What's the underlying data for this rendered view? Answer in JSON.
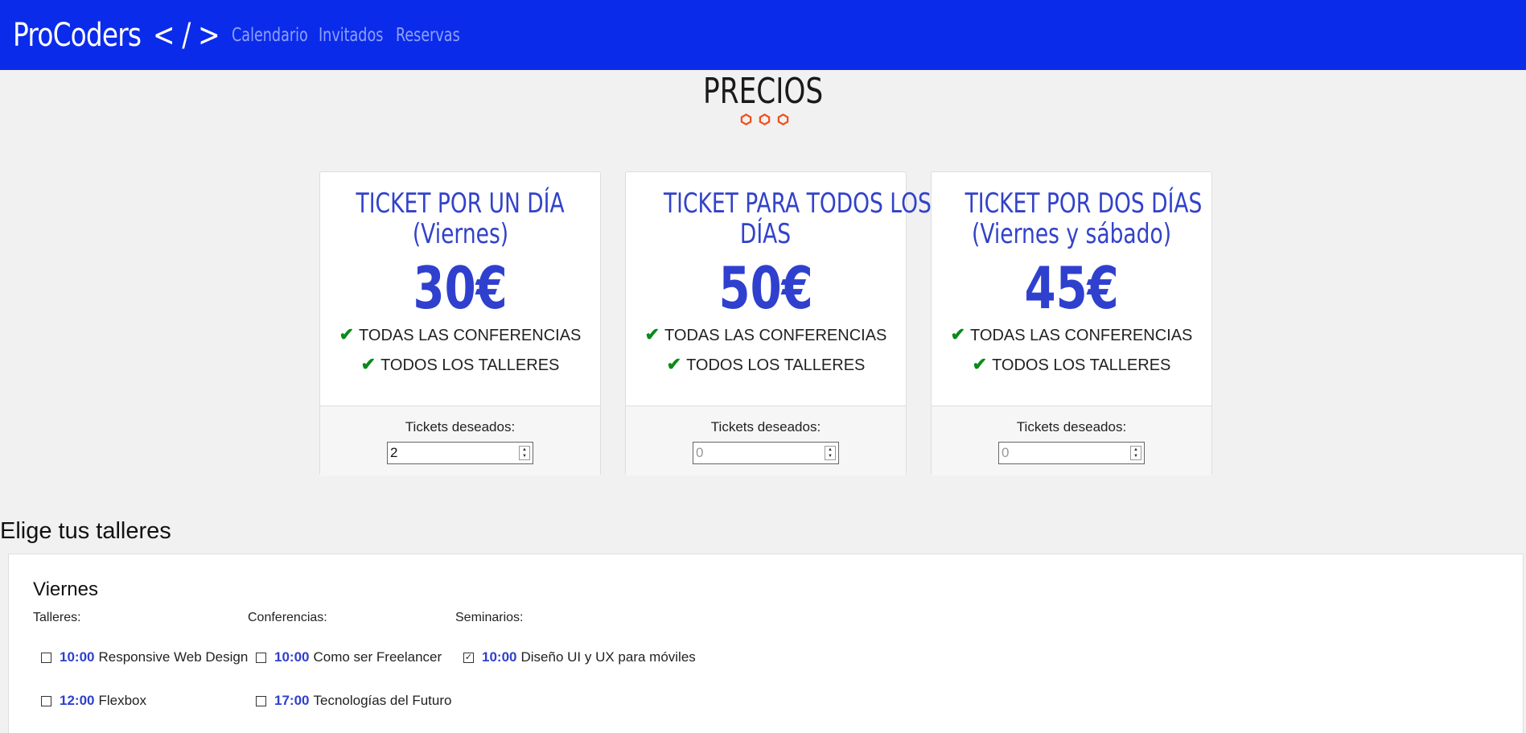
{
  "header": {
    "logo_text": "ProCoders",
    "logo_code": "< / >",
    "nav": [
      "Calendario",
      "Invitados",
      "Reservas"
    ]
  },
  "pricing": {
    "title": "PRECIOS",
    "cards": [
      {
        "title_line1": "TICKET POR UN DÍA",
        "title_line2": "(Viernes)",
        "price": "30€",
        "features": [
          "TODAS LAS CONFERENCIAS",
          "TODOS LOS TALLERES"
        ],
        "qty_label": "Tickets deseados:",
        "qty_value": "2",
        "qty_placeholder": ""
      },
      {
        "title_line1": "TICKET PARA TODOS LOS",
        "title_line2": "DÍAS",
        "price": "50€",
        "features": [
          "TODAS LAS CONFERENCIAS",
          "TODOS LOS TALLERES"
        ],
        "qty_label": "Tickets deseados:",
        "qty_value": "",
        "qty_placeholder": "0"
      },
      {
        "title_line1": "TICKET POR DOS DÍAS",
        "title_line2": "(Viernes y sábado)",
        "price": "45€",
        "features": [
          "TODAS LAS CONFERENCIAS",
          "TODOS LOS TALLERES"
        ],
        "qty_label": "Tickets deseados:",
        "qty_value": "",
        "qty_placeholder": "0"
      }
    ]
  },
  "workshops": {
    "title": "Elige tus talleres",
    "day": "Viernes",
    "columns": [
      {
        "label": "Talleres:",
        "items": [
          {
            "time": "10:00",
            "name": "Responsive Web Design",
            "checked": false
          },
          {
            "time": "12:00",
            "name": "Flexbox",
            "checked": false
          }
        ]
      },
      {
        "label": "Conferencias:",
        "items": [
          {
            "time": "10:00",
            "name": "Como ser Freelancer",
            "checked": false
          },
          {
            "time": "17:00",
            "name": "Tecnologías del Futuro",
            "checked": false
          }
        ]
      },
      {
        "label": "Seminarios:",
        "items": [
          {
            "time": "10:00",
            "name": "Diseño UI y UX para móviles",
            "checked": true
          }
        ]
      }
    ]
  },
  "colors": {
    "header_bg": "#0b2bea",
    "accent": "#2f40cf",
    "check": "#0a8a1a",
    "hex": "#f0501e"
  }
}
